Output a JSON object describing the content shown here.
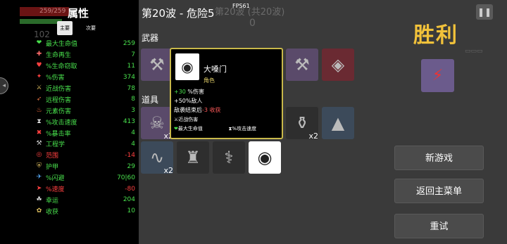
{
  "hud_ghost": {
    "hp": "259/259",
    "count": "102"
  },
  "stats": {
    "title": "属性",
    "tab_main": "主要",
    "tab_secondary": "次要",
    "items": [
      {
        "name": "最大生命值",
        "value": "259",
        "color": "#49e14d",
        "icon": "❤",
        "icon_color": "#49e14d"
      },
      {
        "name": "生命再生",
        "value": "7",
        "color": "#49e14d",
        "icon": "✚",
        "icon_color": "#ff6b6b"
      },
      {
        "name": "%生命窃取",
        "value": "11",
        "color": "#49e14d",
        "icon": "♥",
        "icon_color": "#ff4040"
      },
      {
        "name": "%伤害",
        "value": "374",
        "color": "#49e14d",
        "icon": "✦",
        "icon_color": "#ff4040"
      },
      {
        "name": "近战伤害",
        "value": "78",
        "color": "#49e14d",
        "icon": "⚔",
        "icon_color": "#e0c060"
      },
      {
        "name": "远程伤害",
        "value": "8",
        "color": "#49e14d",
        "icon": "➶",
        "icon_color": "#e07040"
      },
      {
        "name": "元素伤害",
        "value": "3",
        "color": "#49e14d",
        "icon": "♨",
        "icon_color": "#ff7040"
      },
      {
        "name": "%攻击速度",
        "value": "413",
        "color": "#49e14d",
        "icon": "⧗",
        "icon_color": "#e0e0e0"
      },
      {
        "name": "%暴击率",
        "value": "4",
        "color": "#49e14d",
        "icon": "✖",
        "icon_color": "#ff4040"
      },
      {
        "name": "工程学",
        "value": "4",
        "color": "#49e14d",
        "icon": "⚒",
        "icon_color": "#cccccc"
      },
      {
        "name": "范围",
        "value": "-14",
        "color": "#ff4040",
        "icon": "◎",
        "icon_color": "#ff4040"
      },
      {
        "name": "护甲",
        "value": "29",
        "color": "#49e14d",
        "icon": "⛨",
        "icon_color": "#e0c060"
      },
      {
        "name": "%闪避",
        "value": "70|60",
        "color": "#49e14d",
        "icon": "✈",
        "icon_color": "#5ab0ff"
      },
      {
        "name": "%速度",
        "value": "-80",
        "color": "#ff4040",
        "icon": "➤",
        "icon_color": "#ff4040"
      },
      {
        "name": "幸运",
        "value": "204",
        "color": "#49e14d",
        "icon": "☘",
        "icon_color": "#e0e0e0"
      },
      {
        "name": "收获",
        "value": "10",
        "color": "#49e14d",
        "icon": "✿",
        "icon_color": "#e0c060"
      }
    ]
  },
  "wave": {
    "title": "第20波 - 危险5",
    "fps": "FPS61",
    "bg_text": "第20波 (共20波)",
    "bg_number": "0"
  },
  "weapons_label": "武器",
  "items_label": "道具",
  "weapons": [
    {
      "icon": "⚒"
    },
    {
      "icon": "⚒"
    },
    {
      "icon": "⚒"
    },
    {
      "icon": "⚒"
    },
    {
      "icon": "⚒"
    },
    {
      "icon": "◈"
    }
  ],
  "items": [
    {
      "icon": "☠",
      "qty": "x2"
    },
    {
      "icon": "⚱",
      "qty": "x2"
    },
    {
      "icon": "▲",
      "qty": ""
    },
    {
      "icon": "∿",
      "qty": "x2"
    },
    {
      "icon": "♜",
      "qty": ""
    },
    {
      "icon": "⚕",
      "qty": ""
    },
    {
      "icon": "◉",
      "qty": ""
    }
  ],
  "tooltip": {
    "name": "大嗓门",
    "type": "角色",
    "line1_value": "+30",
    "line1_text": " %伤害",
    "line2": "+50%敌人",
    "line3_text": "敌袭结束后",
    "line3_value": "-3 收获",
    "line4": "近战伤害",
    "line5_left": "最大生命值",
    "line5_right": "%攻击速度"
  },
  "victory": "胜利",
  "buttons": {
    "new_game": "新游戏",
    "main_menu": "返回主菜单",
    "retry": "重试"
  },
  "colors": {
    "victory": "#f2c23a",
    "positive": "#49e14d",
    "negative": "#ff4040",
    "tooltip_border": "#c8b84a"
  }
}
